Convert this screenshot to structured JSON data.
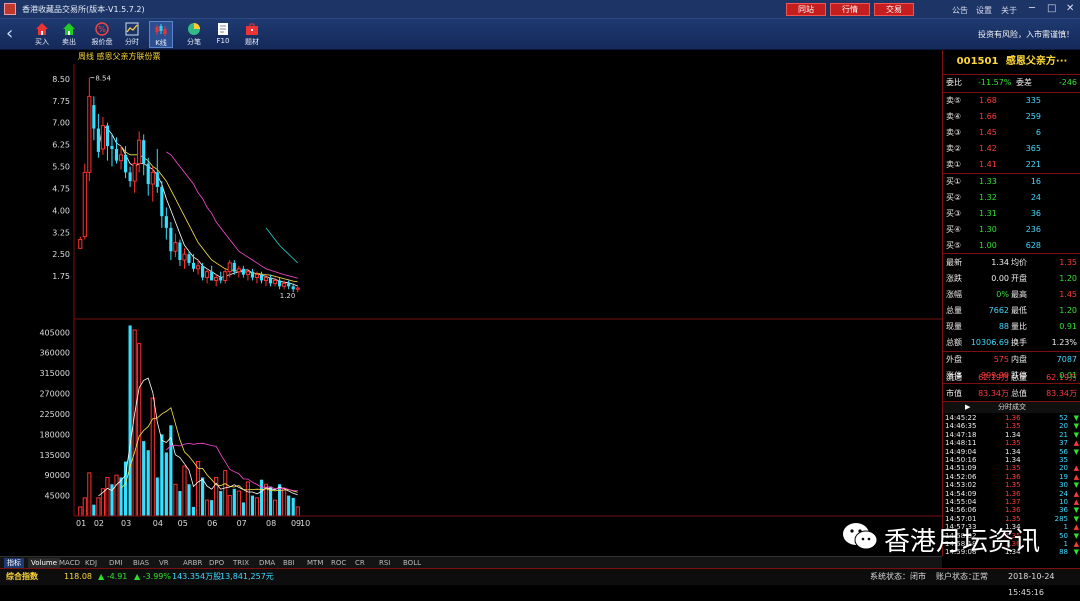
{
  "app": {
    "title": "香港收藏品交易所(版本-V1.5.7.2)"
  },
  "topbar": {
    "buttons": [
      "同站",
      "行情",
      "交易"
    ],
    "links": [
      "公告",
      "设置",
      "关于"
    ],
    "win": [
      "─",
      "□",
      "✕"
    ]
  },
  "toolbar": {
    "items": [
      "买入",
      "卖出",
      "报价盘",
      "分时",
      "K线",
      "分笔",
      "F10",
      "题材"
    ],
    "active": "K线",
    "risk_notice": "投资有风险，入市需谨慎！"
  },
  "chart": {
    "title_period": "周线",
    "title_name": "感恩父亲方联份票"
  },
  "chart_data": [
    {
      "type": "candlestick",
      "title": "周线  感恩父亲方联份票",
      "ylim": [
        1.0,
        8.7
      ],
      "yticks": [
        "8.50",
        "7.75",
        "7.00",
        "6.25",
        "5.50",
        "4.75",
        "4.00",
        "3.25",
        "2.50",
        "1.75"
      ],
      "annotations": [
        {
          "text": "8.54",
          "type": "high"
        },
        {
          "text": "1.20",
          "type": "low"
        }
      ],
      "ohlc": [
        [
          2.7,
          3.1,
          2.7,
          3.0
        ],
        [
          3.1,
          5.6,
          3.0,
          5.3
        ],
        [
          5.3,
          8.54,
          5.0,
          7.9
        ],
        [
          7.6,
          7.9,
          6.4,
          6.8
        ],
        [
          6.8,
          7.3,
          5.8,
          6.0
        ],
        [
          6.1,
          7.2,
          5.9,
          6.9
        ],
        [
          6.9,
          7.0,
          5.7,
          6.2
        ],
        [
          6.2,
          6.6,
          5.5,
          6.1
        ],
        [
          6.1,
          6.5,
          5.6,
          5.7
        ],
        [
          5.7,
          6.2,
          5.4,
          5.9
        ],
        [
          5.9,
          6.2,
          5.1,
          5.3
        ],
        [
          5.3,
          5.5,
          4.8,
          5.0
        ],
        [
          5.0,
          5.8,
          4.6,
          5.6
        ],
        [
          5.6,
          6.7,
          5.3,
          6.4
        ],
        [
          6.4,
          6.6,
          5.2,
          5.6
        ],
        [
          5.6,
          5.8,
          4.5,
          4.9
        ],
        [
          4.9,
          5.5,
          4.3,
          5.3
        ],
        [
          5.3,
          6.1,
          4.6,
          4.8
        ],
        [
          4.8,
          5.0,
          3.4,
          3.8
        ],
        [
          3.8,
          4.1,
          3.0,
          3.4
        ],
        [
          3.4,
          3.6,
          2.3,
          2.6
        ],
        [
          2.6,
          3.2,
          2.4,
          2.9
        ],
        [
          2.9,
          3.0,
          2.1,
          2.3
        ],
        [
          2.3,
          2.7,
          2.0,
          2.5
        ],
        [
          2.5,
          2.6,
          2.1,
          2.2
        ],
        [
          2.2,
          2.5,
          1.9,
          2.0
        ],
        [
          2.0,
          2.3,
          1.8,
          2.1
        ],
        [
          2.1,
          2.2,
          1.6,
          1.7
        ],
        [
          1.7,
          2.0,
          1.5,
          1.9
        ],
        [
          1.9,
          2.1,
          1.6,
          1.6
        ],
        [
          1.6,
          1.8,
          1.4,
          1.7
        ],
        [
          1.7,
          1.9,
          1.5,
          1.6
        ],
        [
          1.6,
          2.0,
          1.5,
          1.9
        ],
        [
          1.9,
          2.3,
          1.7,
          2.2
        ],
        [
          2.2,
          2.3,
          1.8,
          1.9
        ],
        [
          1.9,
          2.1,
          1.7,
          2.0
        ],
        [
          2.0,
          2.1,
          1.7,
          1.8
        ],
        [
          1.8,
          2.0,
          1.6,
          1.9
        ],
        [
          1.9,
          2.0,
          1.6,
          1.7
        ],
        [
          1.7,
          1.9,
          1.5,
          1.8
        ],
        [
          1.8,
          1.9,
          1.5,
          1.6
        ],
        [
          1.6,
          1.8,
          1.4,
          1.7
        ],
        [
          1.7,
          1.8,
          1.4,
          1.5
        ],
        [
          1.5,
          1.7,
          1.4,
          1.6
        ],
        [
          1.6,
          1.7,
          1.3,
          1.4
        ],
        [
          1.4,
          1.6,
          1.3,
          1.5
        ],
        [
          1.5,
          1.6,
          1.3,
          1.4
        ],
        [
          1.4,
          1.5,
          1.2,
          1.3
        ],
        [
          1.3,
          1.4,
          1.2,
          1.34
        ]
      ],
      "ma": [
        {
          "name": "MA5",
          "color": "#ffffff",
          "values": [
            null,
            null,
            null,
            null,
            6.1,
            6.9,
            6.8,
            6.6,
            6.3,
            6.2,
            5.9,
            5.6,
            5.5,
            5.6,
            5.6,
            5.5,
            5.4,
            5.2,
            4.9,
            4.4,
            4.0,
            3.6,
            3.2,
            2.8,
            2.6,
            2.4,
            2.3,
            2.1,
            2.0,
            1.9,
            1.8,
            1.7,
            1.75,
            1.8,
            1.85,
            1.9,
            1.95,
            1.96,
            1.86,
            1.84,
            1.78,
            1.74,
            1.68,
            1.64,
            1.58,
            1.54,
            1.52,
            1.47,
            1.41
          ]
        },
        {
          "name": "MA10",
          "color": "#ffe64a",
          "values": [
            null,
            null,
            null,
            null,
            null,
            null,
            null,
            null,
            null,
            6.2,
            6.0,
            5.9,
            5.9,
            5.9,
            5.8,
            5.7,
            5.5,
            5.4,
            5.2,
            5.0,
            4.7,
            4.4,
            4.1,
            3.8,
            3.5,
            3.2,
            2.9,
            2.7,
            2.5,
            2.3,
            2.2,
            2.1,
            2.0,
            1.95,
            1.95,
            1.9,
            1.9,
            1.88,
            1.86,
            1.84,
            1.82,
            1.8,
            1.78,
            1.74,
            1.7,
            1.66,
            1.62,
            1.58,
            1.55
          ]
        },
        {
          "name": "MA20",
          "color": "#ff4ad8",
          "values": [
            null,
            null,
            null,
            null,
            null,
            null,
            null,
            null,
            null,
            null,
            null,
            null,
            null,
            null,
            null,
            null,
            null,
            null,
            null,
            6.0,
            5.9,
            5.7,
            5.5,
            5.3,
            5.1,
            4.9,
            4.6,
            4.4,
            4.1,
            3.9,
            3.6,
            3.4,
            3.2,
            3.0,
            2.8,
            2.6,
            2.5,
            2.4,
            2.3,
            2.2,
            2.1,
            2.0,
            1.95,
            1.9,
            1.85,
            1.8,
            1.76,
            1.72,
            1.68
          ]
        },
        {
          "name": "MA60",
          "color": "#2ad0d0",
          "values": [
            null,
            null,
            null,
            null,
            null,
            null,
            null,
            null,
            null,
            null,
            null,
            null,
            null,
            null,
            null,
            null,
            null,
            null,
            null,
            null,
            null,
            null,
            null,
            null,
            null,
            null,
            null,
            null,
            null,
            null,
            null,
            null,
            null,
            null,
            null,
            null,
            null,
            null,
            null,
            null,
            null,
            3.4,
            3.2,
            3.0,
            2.8,
            2.65,
            2.5,
            2.35,
            2.2
          ]
        }
      ]
    },
    {
      "type": "bar",
      "title": "Volume",
      "ylim": [
        0,
        410000
      ],
      "yticks": [
        "405000",
        "360000",
        "315000",
        "270000",
        "225000",
        "180000",
        "135000",
        "90000",
        "45000"
      ],
      "x_labels": [
        "01",
        "02",
        "03",
        "04",
        "05",
        "06",
        "07",
        "08",
        "09",
        "10"
      ],
      "values": [
        20000,
        40000,
        95000,
        25000,
        40000,
        60000,
        85000,
        70000,
        90000,
        85000,
        120000,
        420000,
        410000,
        380000,
        165000,
        145000,
        260000,
        85000,
        180000,
        140000,
        200000,
        70000,
        55000,
        110000,
        70000,
        20000,
        120000,
        85000,
        35000,
        35000,
        85000,
        55000,
        100000,
        45000,
        60000,
        55000,
        30000,
        75000,
        45000,
        40000,
        80000,
        70000,
        65000,
        35000,
        70000,
        60000,
        45000,
        40000,
        20000
      ],
      "up": [
        true,
        true,
        true,
        false,
        true,
        true,
        true,
        false,
        true,
        false,
        false,
        false,
        true,
        true,
        false,
        false,
        true,
        false,
        false,
        false,
        false,
        true,
        false,
        true,
        false,
        false,
        true,
        false,
        true,
        false,
        true,
        false,
        true,
        true,
        false,
        true,
        false,
        true,
        false,
        true,
        false,
        true,
        false,
        true,
        false,
        true,
        false,
        false,
        true
      ],
      "ma": [
        {
          "name": "MA5",
          "color": "#ffffff"
        },
        {
          "name": "MA10",
          "color": "#ffe64a"
        },
        {
          "name": "MA20",
          "color": "#ff4ad8"
        }
      ]
    }
  ],
  "tabs": [
    "指标",
    "Volume",
    "MACD",
    "KDJ",
    "DMI",
    "BIAS",
    "VR",
    "ARBR",
    "DPO",
    "TRIX",
    "DMA",
    "BBI",
    "MTM",
    "ROC",
    "CR",
    "RSI",
    "BOLL"
  ],
  "quote": {
    "code": "001501",
    "name": "感恩父亲方···",
    "weibi": {
      "label": "委比",
      "value": "-11.57%",
      "label2": "委差",
      "value2": "-246"
    },
    "sell": [
      {
        "label": "卖⑤",
        "price": "1.68",
        "vol": "335"
      },
      {
        "label": "卖④",
        "price": "1.66",
        "vol": "259"
      },
      {
        "label": "卖③",
        "price": "1.45",
        "vol": "6"
      },
      {
        "label": "卖②",
        "price": "1.42",
        "vol": "365"
      },
      {
        "label": "卖①",
        "price": "1.41",
        "vol": "221"
      }
    ],
    "buy": [
      {
        "label": "买①",
        "price": "1.33",
        "vol": "16"
      },
      {
        "label": "买②",
        "price": "1.32",
        "vol": "24"
      },
      {
        "label": "买③",
        "price": "1.31",
        "vol": "36"
      },
      {
        "label": "买④",
        "price": "1.30",
        "vol": "236"
      },
      {
        "label": "买⑤",
        "price": "1.00",
        "vol": "628"
      }
    ],
    "stats": [
      {
        "l1": "最新",
        "v1": "1.34",
        "c1": "w",
        "l2": "均价",
        "v2": "1.35",
        "c2": "r"
      },
      {
        "l1": "涨跌",
        "v1": "0.00",
        "c1": "w",
        "l2": "开盘",
        "v2": "1.20",
        "c2": "g"
      },
      {
        "l1": "涨幅",
        "v1": "0%",
        "c1": "g",
        "l2": "最高",
        "v2": "1.45",
        "c2": "r"
      },
      {
        "l1": "总量",
        "v1": "7662",
        "c1": "c",
        "l2": "最低",
        "v2": "1.20",
        "c2": "g"
      },
      {
        "l1": "现量",
        "v1": "88",
        "c1": "c",
        "l2": "量比",
        "v2": "0.91",
        "c2": "g"
      },
      {
        "l1": "总额",
        "v1": "10306.69",
        "c1": "c",
        "l2": "换手",
        "v2": "1.23%",
        "c2": "w"
      }
    ],
    "stats2": [
      {
        "l1": "外盘",
        "v1": "575",
        "c1": "r",
        "l2": "内盘",
        "v2": "7087",
        "c2": "c"
      },
      {
        "l1": "涨停",
        "v1": "999.99",
        "c1": "r",
        "l2": "跌停",
        "v2": "0.01",
        "c2": "g"
      }
    ],
    "stats3": [
      {
        "l1": "流通",
        "v1": "62.19万",
        "c1": "r",
        "l2": "总量",
        "v2": "62.19万",
        "c2": "r"
      },
      {
        "l1": "市值",
        "v1": "83.34万",
        "c1": "r",
        "l2": "总值",
        "v2": "83.34万",
        "c2": "r"
      }
    ],
    "ticks_title": "分时成交",
    "ticks": [
      {
        "t": "14:45:22",
        "p": "1.36",
        "pc": "r",
        "v": "52",
        "d": "down"
      },
      {
        "t": "14:46:35",
        "p": "1.35",
        "pc": "r",
        "v": "20",
        "d": "down"
      },
      {
        "t": "14:47:18",
        "p": "1.34",
        "pc": "w",
        "v": "21",
        "d": "down"
      },
      {
        "t": "14:48:11",
        "p": "1.35",
        "pc": "r",
        "v": "37",
        "d": "up"
      },
      {
        "t": "14:49:04",
        "p": "1.34",
        "pc": "w",
        "v": "56",
        "d": "down"
      },
      {
        "t": "14:50:16",
        "p": "1.34",
        "pc": "w",
        "v": "35",
        "d": "none"
      },
      {
        "t": "14:51:09",
        "p": "1.35",
        "pc": "r",
        "v": "20",
        "d": "up"
      },
      {
        "t": "14:52:06",
        "p": "1.36",
        "pc": "r",
        "v": "19",
        "d": "up"
      },
      {
        "t": "14:53:02",
        "p": "1.35",
        "pc": "r",
        "v": "30",
        "d": "down"
      },
      {
        "t": "14:54:09",
        "p": "1.36",
        "pc": "r",
        "v": "24",
        "d": "up"
      },
      {
        "t": "14:55:04",
        "p": "1.37",
        "pc": "r",
        "v": "10",
        "d": "up"
      },
      {
        "t": "14:56:06",
        "p": "1.36",
        "pc": "r",
        "v": "36",
        "d": "down"
      },
      {
        "t": "14:57:01",
        "p": "1.35",
        "pc": "r",
        "v": "285",
        "d": "down"
      },
      {
        "t": "14:57:33",
        "p": "1.34",
        "pc": "w",
        "v": "1",
        "d": "up"
      },
      {
        "t": "14:58:02",
        "p": "1.35",
        "pc": "r",
        "v": "50",
        "d": "down"
      },
      {
        "t": "14:58:18",
        "p": "1.36",
        "pc": "r",
        "v": "1",
        "d": "up"
      },
      {
        "t": "14:59:08",
        "p": "1.34",
        "pc": "w",
        "v": "88",
        "d": "down"
      }
    ]
  },
  "watermark": "香港月坛资讯",
  "status": {
    "index_label": "综合指数",
    "index": "118.08",
    "chg": "▲ -4.91",
    "pct": "▲ -3.99%",
    "vol": "143.354万股",
    "amt": "13,841,257元",
    "sys_label": "系统状态：",
    "sys": "闭市",
    "acct_label": "账户状态：",
    "acct": "正常",
    "time": "2018-10-24 15:45:16"
  }
}
